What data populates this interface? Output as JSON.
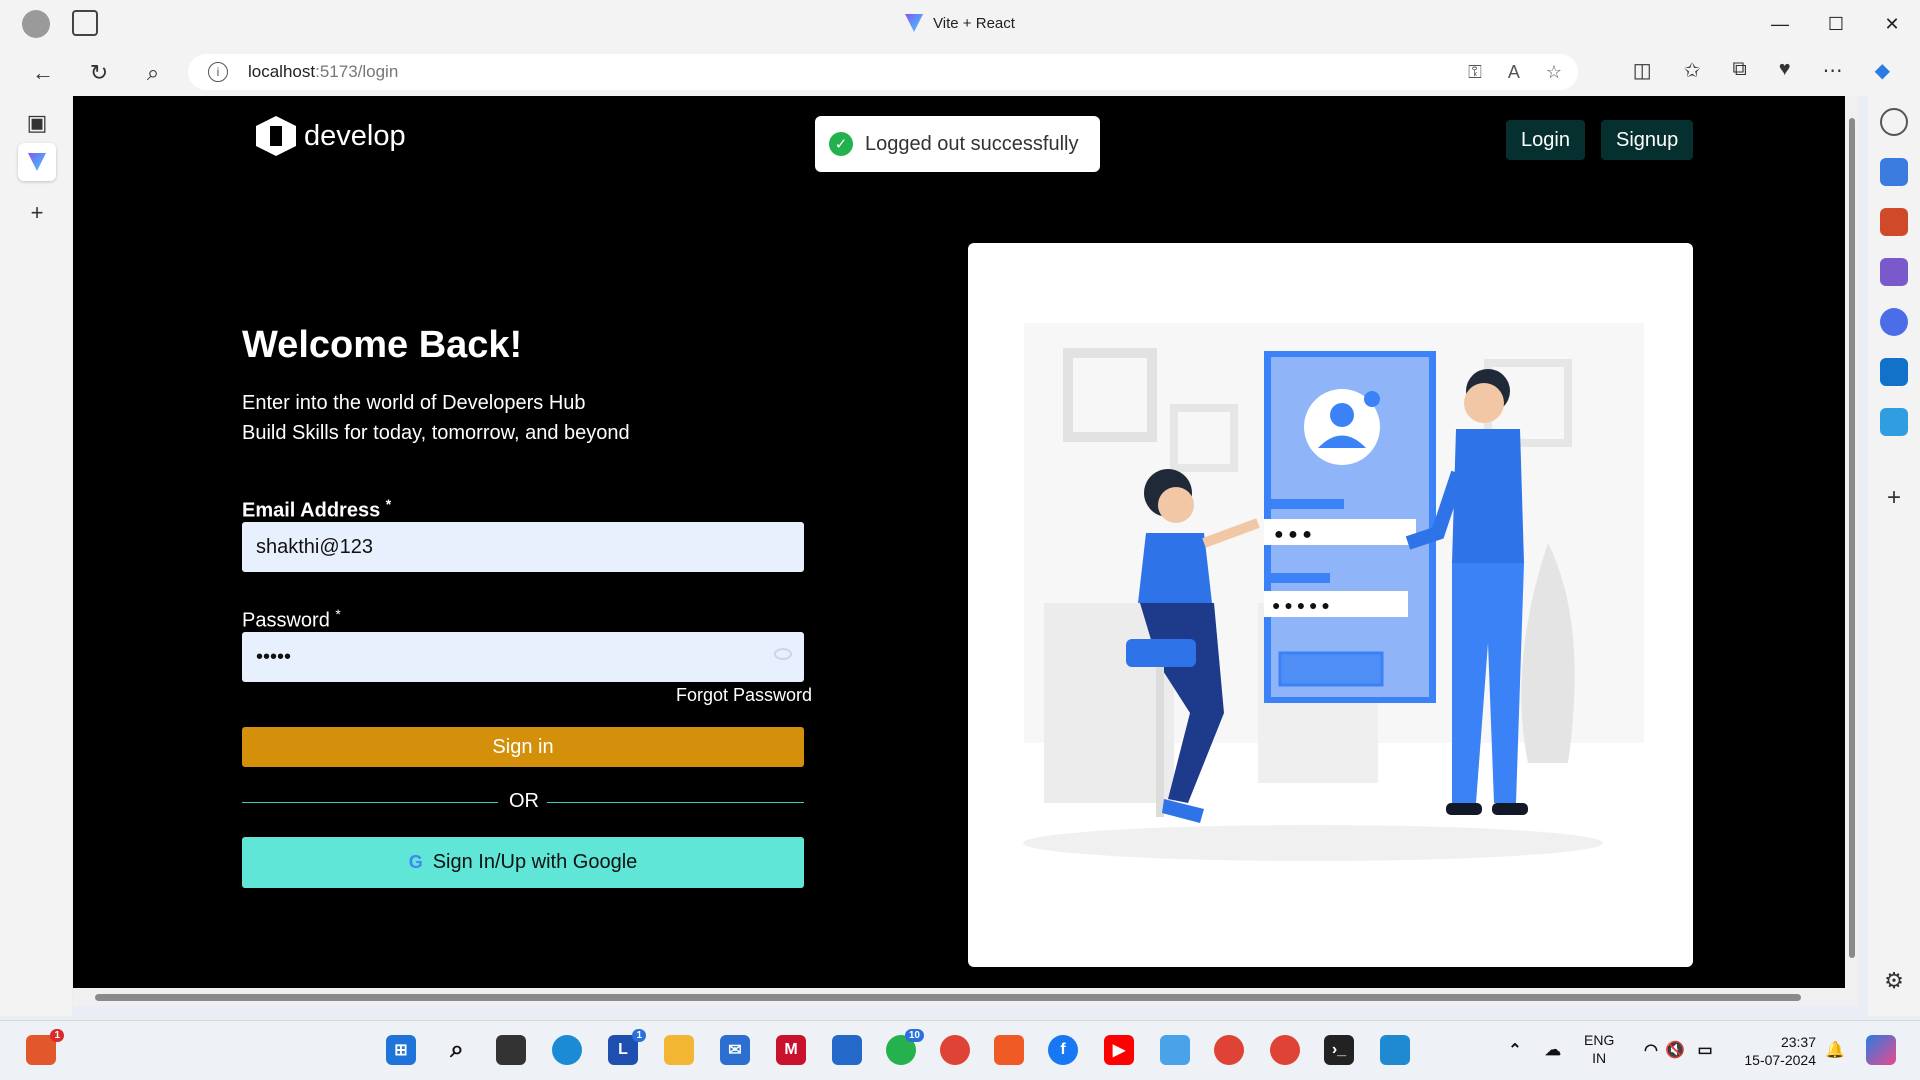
{
  "browser": {
    "window_title": "Vite + React",
    "url_host": "localhost",
    "url_path": ":5173/login",
    "tabs": [
      {
        "name": "Vite + React",
        "icon": "vite-icon"
      }
    ]
  },
  "page": {
    "brand": "develop",
    "nav": {
      "login_label": "Login",
      "signup_label": "Signup"
    },
    "toast": {
      "message": "Logged out successfully"
    },
    "welcome_title": "Welcome Back!",
    "subtitle_line1": "Enter into the world of Developers Hub",
    "subtitle_line2": "Build Skills for today, tomorrow, and beyond",
    "email": {
      "label": "Email Address",
      "required_mark": "*",
      "value": "shakthi@123"
    },
    "password": {
      "label": "Password",
      "required_mark": "*",
      "value": "•••••"
    },
    "forgot_label": "Forgot Password",
    "signin_label": "Sign in",
    "or_label": "OR",
    "google_label": "Sign In/Up with Google",
    "google_icon": "G",
    "illustration": {
      "password_dots_1": "● ● ●",
      "password_dots_2": "● ● ● ● ●"
    }
  },
  "taskbar": {
    "antivirus_badge": "1",
    "l_app_badge": "1",
    "whatsapp_badge": "10",
    "lang_line1": "ENG",
    "lang_line2": "IN",
    "time": "23:37",
    "date": "15-07-2024"
  },
  "colors": {
    "page_bg": "#000000",
    "signin_button": "#d4900a",
    "google_button": "#5fe6d6",
    "nav_buttons": "#06302f",
    "toast_check": "#22b14c",
    "illustration_accent": "#3b82f6"
  }
}
